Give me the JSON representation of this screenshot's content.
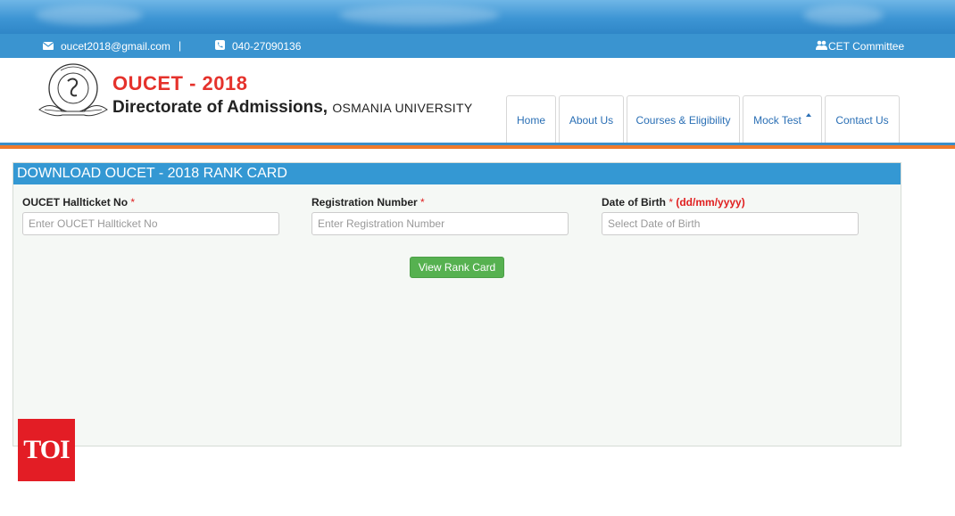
{
  "contact": {
    "email": "oucet2018@gmail.com",
    "separator": "|",
    "phone": "040-27090136",
    "committee": "CET Committee"
  },
  "brand": {
    "title": "OUCET - 2018",
    "subtitle_main": "Directorate of Admissions,",
    "subtitle_small": "OSMANIA UNIVERSITY"
  },
  "nav": {
    "items": [
      "Home",
      "About Us",
      "Courses & Eligibility",
      "Mock Test",
      "Contact Us"
    ]
  },
  "form": {
    "heading": "DOWNLOAD OUCET - 2018 RANK CARD",
    "hallticket_label": "OUCET Hallticket No",
    "hallticket_placeholder": "Enter OUCET Hallticket No",
    "registration_label": "Registration Number",
    "registration_placeholder": "Enter Registration Number",
    "dob_label": "Date of Birth",
    "dob_format": "(dd/mm/yyyy)",
    "dob_placeholder": "Select Date of Birth",
    "required_mark": "*",
    "submit_label": "View Rank Card"
  },
  "watermark": {
    "text": "TOI"
  },
  "colors": {
    "accent_blue": "#3498d3",
    "brand_red": "#e5322c",
    "button_green": "#56b150",
    "stripe_orange": "#f07a2b"
  }
}
